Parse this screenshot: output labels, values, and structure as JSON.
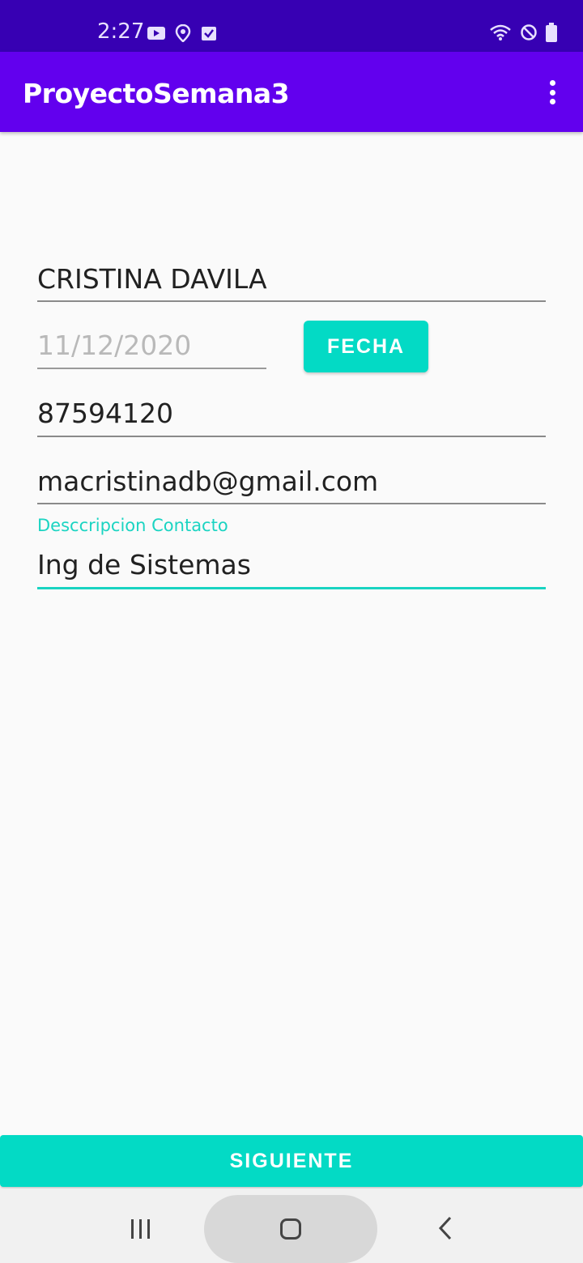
{
  "status_bar": {
    "time": "2:27",
    "left_icons": [
      "youtube-icon",
      "location-icon",
      "task-icon"
    ],
    "right_icons": [
      "wifi-icon",
      "block-icon",
      "battery-icon"
    ]
  },
  "app_bar": {
    "title": "ProyectoSemana3",
    "overflow_icon": "more-vert-icon"
  },
  "form": {
    "name_value": "CRISTINA DAVILA",
    "date_value": "11/12/2020",
    "date_button_label": "FECHA",
    "phone_value": "87594120",
    "email_value": "macristinadb@gmail.com",
    "description_label": "Desccripcion Contacto",
    "description_value": "Ing de Sistemas"
  },
  "next_button_label": "SIGUIENTE",
  "colors": {
    "status_bar": "#3700b3",
    "app_bar": "#6200ee",
    "accent": "#03dac5",
    "background": "#fafafa"
  },
  "nav_bar": {
    "icons": [
      "recent-apps-icon",
      "home-icon",
      "back-icon"
    ]
  }
}
